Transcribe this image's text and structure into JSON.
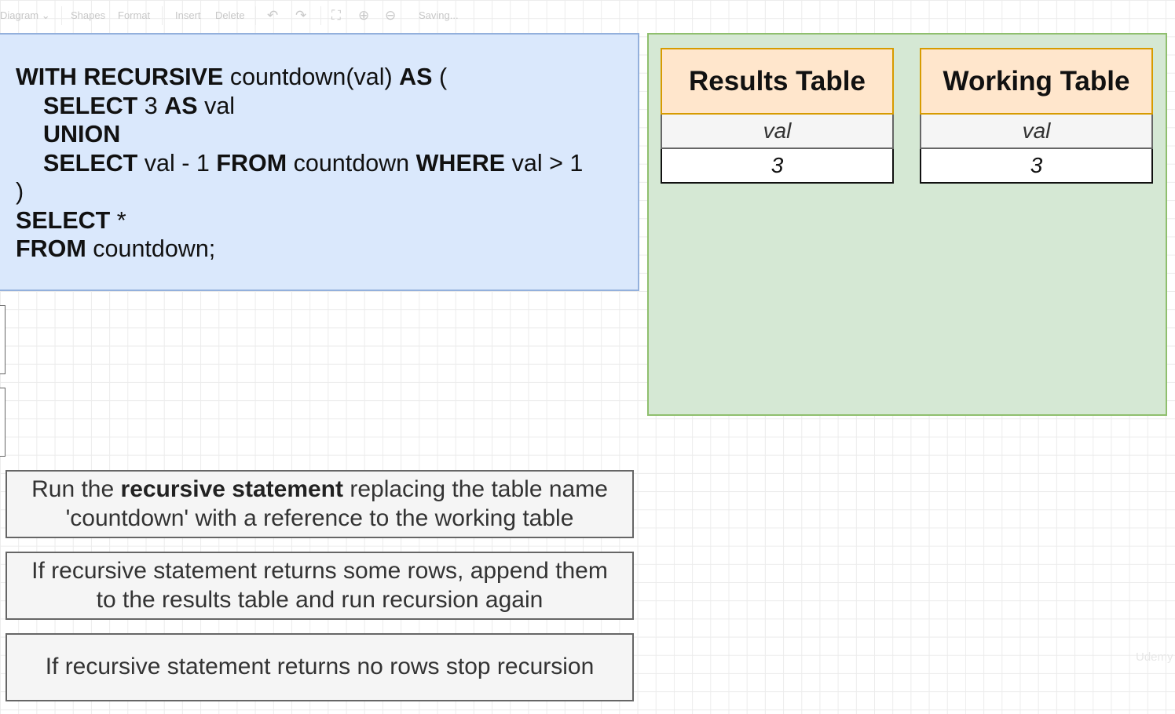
{
  "toolbar": {
    "diagram": "Diagram",
    "shapes": "Shapes",
    "format": "Format",
    "insert": "Insert",
    "delete": "Delete",
    "status": "Saving..."
  },
  "sql": {
    "line1_kw1": "WITH RECURSIVE",
    "line1_t1": " countdown(val) ",
    "line1_kw2": "AS",
    "line1_t2": " (",
    "line2_kw1": "SELECT",
    "line2_t1": " 3 ",
    "line2_kw2": "AS",
    "line2_t2": " val",
    "line3_kw1": "UNION",
    "line4_kw1": "SELECT",
    "line4_t1": " val - 1 ",
    "line4_kw2": "FROM",
    "line4_t2": " countdown ",
    "line4_kw3": "WHERE",
    "line4_t3": " val > 1",
    "line5_t1": ")",
    "line6_kw1": "SELECT",
    "line6_t1": " *",
    "line7_kw1": "FROM",
    "line7_t1": " countdown;"
  },
  "results_table": {
    "title": "Results Table",
    "column": "val",
    "rows": [
      "3"
    ]
  },
  "working_table": {
    "title": "Working Table",
    "column": "val",
    "rows": [
      "3"
    ]
  },
  "steps": {
    "step1_a": "Run the ",
    "step1_b": "recursive statement",
    "step1_c": " replacing the table name",
    "step1_d": "'countdown' with a reference to the working table",
    "step2_a": "If recursive statement returns some rows, append them",
    "step2_b": "to the results table and run recursion again",
    "step3": "If recursive statement returns no rows stop recursion"
  },
  "watermark": "Udemy"
}
